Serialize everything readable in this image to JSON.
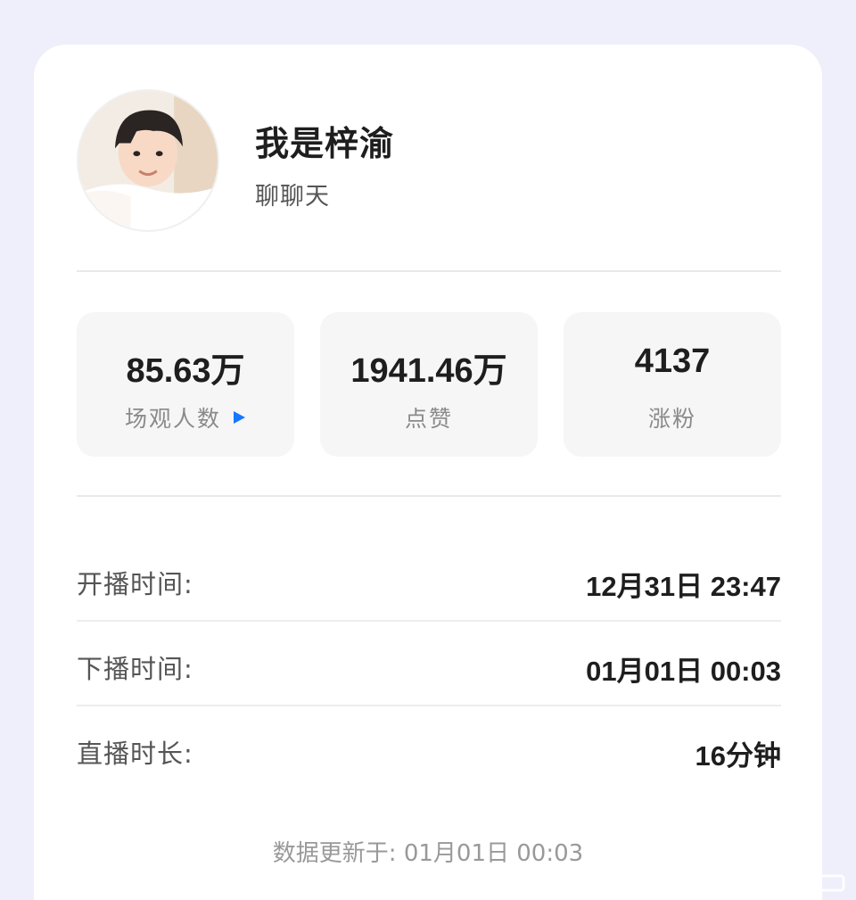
{
  "profile": {
    "name": "我是梓渝",
    "subtitle": "聊聊天",
    "avatar_icon": "person-avatar"
  },
  "stats": [
    {
      "value": "85.63万",
      "label": "场观人数",
      "icon": "play-icon",
      "icon_color": "#1677ff"
    },
    {
      "value": "1941.46万",
      "label": "点赞"
    },
    {
      "value": "4137",
      "label": "涨粉"
    }
  ],
  "details": [
    {
      "label": "开播时间:",
      "value": "12月31日 23:47"
    },
    {
      "label": "下播时间:",
      "value": "01月01日 00:03"
    },
    {
      "label": "直播时长:",
      "value": "16分钟"
    }
  ],
  "footer": {
    "updated_text": "数据更新于: 01月01日 00:03"
  },
  "colors": {
    "page_background": "#efeefb",
    "card_background": "#ffffff",
    "stat_background": "#f6f6f7",
    "accent": "#1677ff"
  }
}
